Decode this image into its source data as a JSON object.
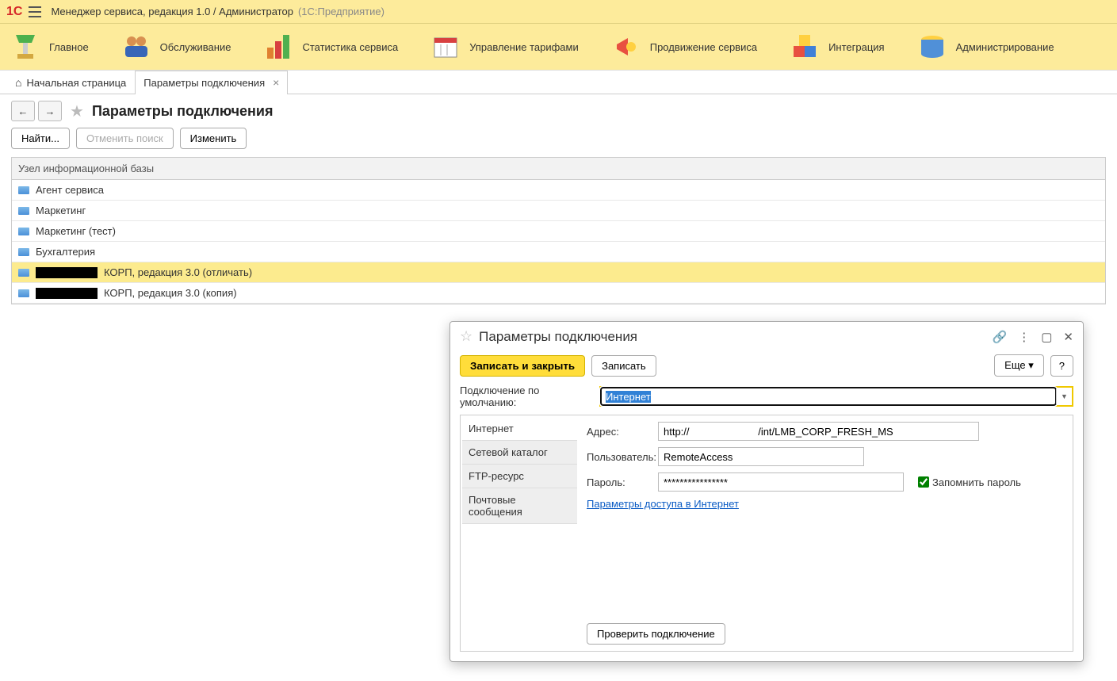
{
  "topbar": {
    "logo": "1C",
    "title": "Менеджер сервиса, редакция 1.0 / Администратор",
    "subtitle": "(1С:Предприятие)"
  },
  "ribbon": [
    {
      "label": "Главное",
      "name": "nav-main"
    },
    {
      "label": "Обслуживание",
      "name": "nav-service"
    },
    {
      "label": "Статистика сервиса",
      "name": "nav-stats"
    },
    {
      "label": "Управление тарифами",
      "name": "nav-tariffs"
    },
    {
      "label": "Продвижение сервиса",
      "name": "nav-promo"
    },
    {
      "label": "Интеграция",
      "name": "nav-integration"
    },
    {
      "label": "Администрирование",
      "name": "nav-admin"
    }
  ],
  "tabs": {
    "home": "Начальная страница",
    "params": "Параметры подключения"
  },
  "page": {
    "title": "Параметры подключения",
    "find": "Найти...",
    "cancel_find": "Отменить поиск",
    "edit": "Изменить",
    "grid_header": "Узел информационной базы",
    "rows": [
      {
        "text": "Агент сервиса"
      },
      {
        "text": "Маркетинг"
      },
      {
        "text": "Маркетинг (тест)"
      },
      {
        "text": "Бухгалтерия"
      },
      {
        "text": "КОРП, редакция 3.0 (отличать)",
        "redacted": true,
        "selected": true
      },
      {
        "text": "КОРП, редакция 3.0 (копия)",
        "redacted": true
      }
    ]
  },
  "dialog": {
    "title": "Параметры подключения",
    "save_close": "Записать и закрыть",
    "save": "Записать",
    "more": "Еще",
    "help": "?",
    "default_conn_label": "Подключение по умолчанию:",
    "default_conn_value": "Интернет",
    "tabs": [
      "Интернет",
      "Сетевой каталог",
      "FTP-ресурс",
      "Почтовые сообщения"
    ],
    "form": {
      "address_label": "Адрес:",
      "address_prefix": "http://",
      "address_suffix": "/int/LMB_CORP_FRESH_MS",
      "user_label": "Пользователь:",
      "user_value": "RemoteAccess",
      "pass_label": "Пароль:",
      "pass_value": "****************",
      "remember": "Запомнить пароль",
      "link": "Параметры доступа в Интернет",
      "test_btn": "Проверить подключение"
    }
  }
}
